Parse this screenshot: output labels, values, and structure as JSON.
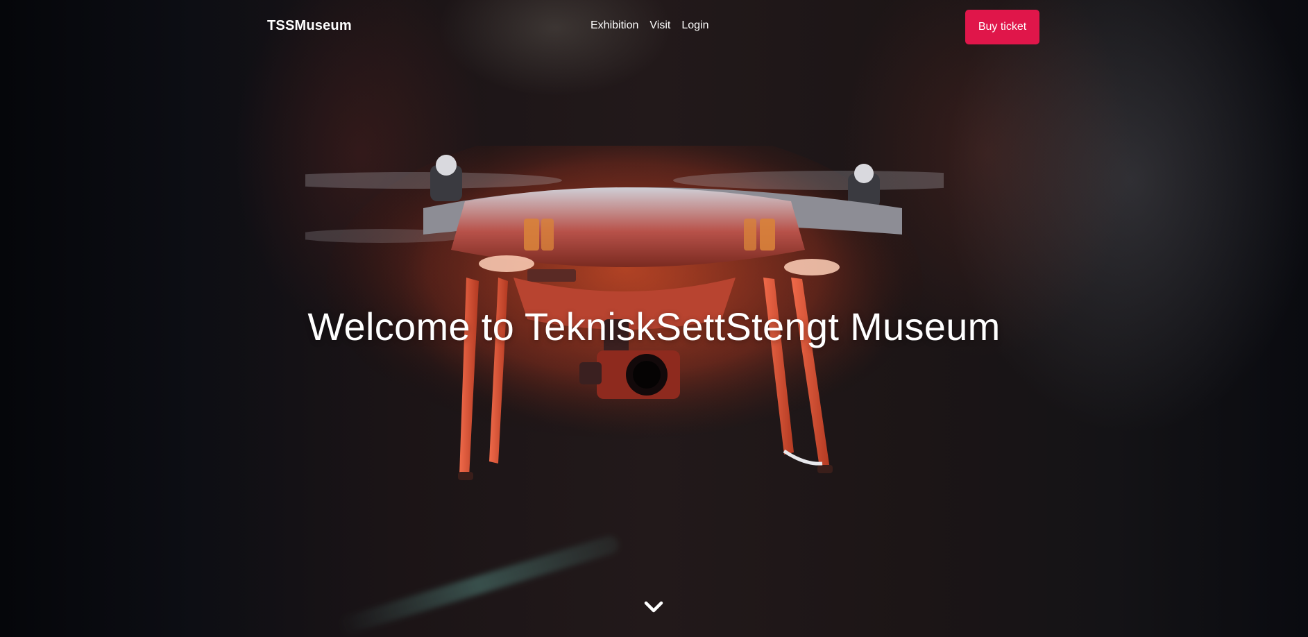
{
  "header": {
    "logo": "TSSMuseum",
    "nav_links": [
      {
        "label": "Exhibition"
      },
      {
        "label": "Visit"
      },
      {
        "label": "Login"
      }
    ],
    "cta_label": "Buy ticket"
  },
  "hero": {
    "title": "Welcome to TekniskSettStengt Museum",
    "scroll_icon": "chevron-down-icon"
  },
  "colors": {
    "accent": "#e0164a",
    "text": "#ffffff",
    "background": "#07080d"
  }
}
